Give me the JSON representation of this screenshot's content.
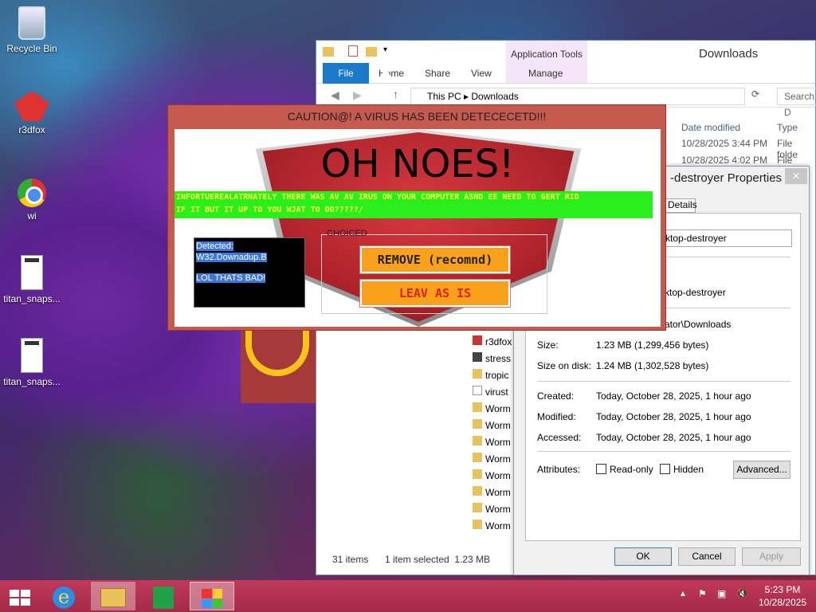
{
  "desktop": {
    "icons": [
      {
        "label": "Recycle Bin",
        "icon": "recycle-bin-icon"
      },
      {
        "label": "r3dfox",
        "icon": "r3dfox-icon"
      },
      {
        "label": "wi",
        "icon": "chrome-icon"
      },
      {
        "label": "titan_snaps...",
        "icon": "document-icon"
      },
      {
        "label": "titan_snaps...",
        "icon": "document-icon"
      }
    ]
  },
  "explorer": {
    "title": "Downloads",
    "contextual_group": "Application Tools",
    "tabs": [
      "File",
      "Home",
      "Share",
      "View",
      "Manage"
    ],
    "address": {
      "crumbs": [
        "This PC",
        "Downloads"
      ]
    },
    "search_placeholder": "Search D",
    "columns": [
      "Date modified",
      "Type"
    ],
    "rows_meta": [
      {
        "date": "10/28/2025 3:44 PM",
        "type": "File folde"
      },
      {
        "date": "10/28/2025 4:02 PM",
        "type": "File folde"
      }
    ],
    "files": [
      "r3dfox",
      "stress",
      "tropic",
      "virust",
      "Worm",
      "Worm",
      "Worm",
      "Worm",
      "Worm",
      "Worm",
      "Worm",
      "Worm"
    ],
    "status": {
      "items": "31 items",
      "selected": "1 item selected  1.23 MB"
    }
  },
  "properties": {
    "title": "-destroyer Properties",
    "tab": "Details",
    "name_field": "ktop-destroyer",
    "type_value": "ktop-destroyer",
    "location": "ator\\Downloads",
    "size_label": "Size:",
    "size_value": "1.23 MB (1,299,456 bytes)",
    "disk_label": "Size on disk:",
    "disk_value": "1.24 MB (1,302,528 bytes)",
    "created_label": "Created:",
    "created_value": "Today, October 28, 2025, 1 hour ago",
    "modified_label": "Modified:",
    "modified_value": "Today, October 28, 2025, 1 hour ago",
    "accessed_label": "Accessed:",
    "accessed_value": "Today, October 28, 2025, 1 hour ago",
    "attributes_label": "Attributes:",
    "readonly_label": "Read-only",
    "hidden_label": "Hidden",
    "advanced_label": "Advanced...",
    "ok_label": "OK",
    "cancel_label": "Cancel",
    "apply_label": "Apply"
  },
  "popup": {
    "title": "CAUTION@! A VIRUS HAS BEEN DETECECETD!!!",
    "headline": "OH NOES!",
    "banner_line1": "INFORTUEREALATRNATELY THERE WAS AV AV IRUS ON YOUR COMPUTER ASND EE NEED TO GERT RID",
    "banner_line2": "IF IT BUT IT UP TO YOU WJAT TO DO?????/",
    "detected_lines": [
      "Detected:",
      "W32.Downadup.B",
      "LOL THATS BAD!"
    ],
    "group_label": "CHOICED",
    "remove_label": "REMOVE (recomnd)",
    "leave_label": "LEAV AS IS",
    "colors": {
      "title_bar": "#c65a4e",
      "banner_bg": "#2bef1c",
      "banner_text": "#ffff40",
      "button_bg": "#f9a11b"
    }
  },
  "taskbar": {
    "time": "5:23 PM",
    "date": "10/28/2025",
    "items": [
      "start-icon",
      "internet-explorer-icon",
      "file-explorer-icon",
      "store-icon",
      "virus-app-icon"
    ]
  }
}
